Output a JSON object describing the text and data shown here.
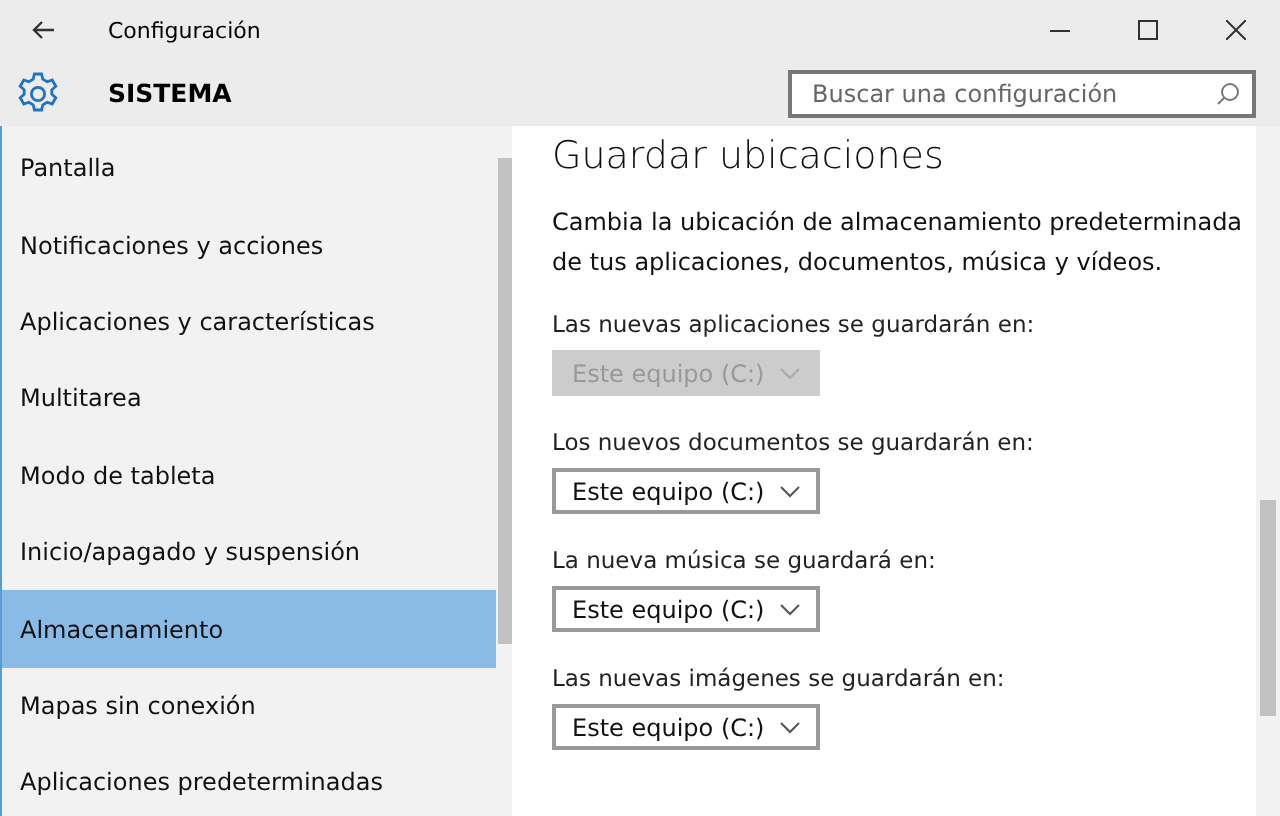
{
  "window": {
    "title": "Configuración"
  },
  "header": {
    "title": "SISTEMA",
    "search": {
      "placeholder": "Buscar una configuración"
    }
  },
  "sidebar": {
    "items": [
      {
        "label": "Pantalla",
        "selected": false
      },
      {
        "label": "Notificaciones y acciones",
        "selected": false
      },
      {
        "label": "Aplicaciones y características",
        "selected": false
      },
      {
        "label": "Multitarea",
        "selected": false
      },
      {
        "label": "Modo de tableta",
        "selected": false
      },
      {
        "label": "Inicio/apagado y suspensión",
        "selected": false
      },
      {
        "label": "Almacenamiento",
        "selected": true
      },
      {
        "label": "Mapas sin conexión",
        "selected": false
      },
      {
        "label": "Aplicaciones predeterminadas",
        "selected": false
      }
    ]
  },
  "content": {
    "heading": "Guardar ubicaciones",
    "description": "Cambia la ubicación de almacenamiento predeterminada de tus aplicaciones, documentos, música y vídeos.",
    "settings": [
      {
        "label": "Las nuevas aplicaciones se guardarán en:",
        "value": "Este equipo (C:)",
        "disabled": true
      },
      {
        "label": "Los nuevos documentos se guardarán en:",
        "value": "Este equipo (C:)",
        "disabled": false
      },
      {
        "label": "La nueva música se guardará en:",
        "value": "Este equipo (C:)",
        "disabled": false
      },
      {
        "label": "Las nuevas imágenes se guardarán en:",
        "value": "Este equipo (C:)",
        "disabled": false
      }
    ]
  }
}
